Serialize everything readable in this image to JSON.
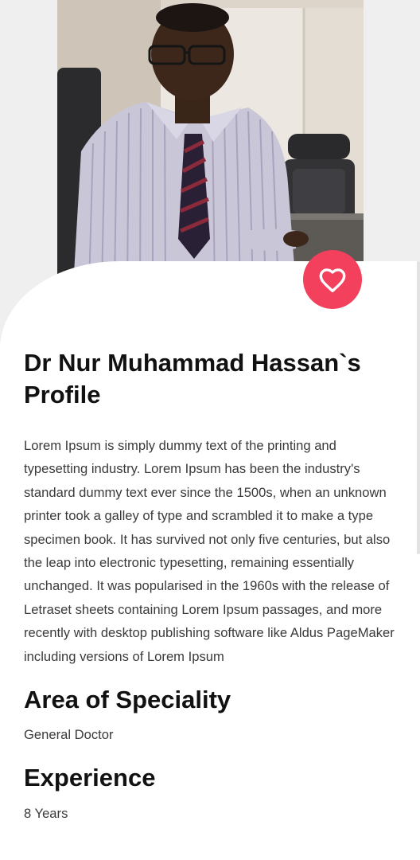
{
  "profile": {
    "title": "Dr Nur Muhammad Hassan`s Profile",
    "bio": "Lorem Ipsum is simply dummy text of the printing and typesetting industry. Lorem Ipsum has been the industry's standard dummy text ever since the 1500s, when an unknown printer took a galley of type and scrambled it to make a type specimen book. It has survived not only five centuries, but also the leap into electronic typesetting, remaining essentially unchanged. It was popularised in the 1960s with the release of Letraset sheets containing Lorem Ipsum passages, and more recently with desktop publishing software like Aldus PageMaker including versions of Lorem Ipsum"
  },
  "specialty": {
    "heading": "Area of Speciality",
    "value": "General Doctor"
  },
  "experience": {
    "heading": "Experience",
    "value": "8 Years"
  },
  "favorite": {
    "icon": "heart-outline-icon",
    "color": "#f2405d"
  },
  "colors": {
    "accent": "#f2405d",
    "background": "#efefef",
    "card": "#ffffff",
    "heading": "#111111",
    "body_text": "#3a3a3a"
  }
}
